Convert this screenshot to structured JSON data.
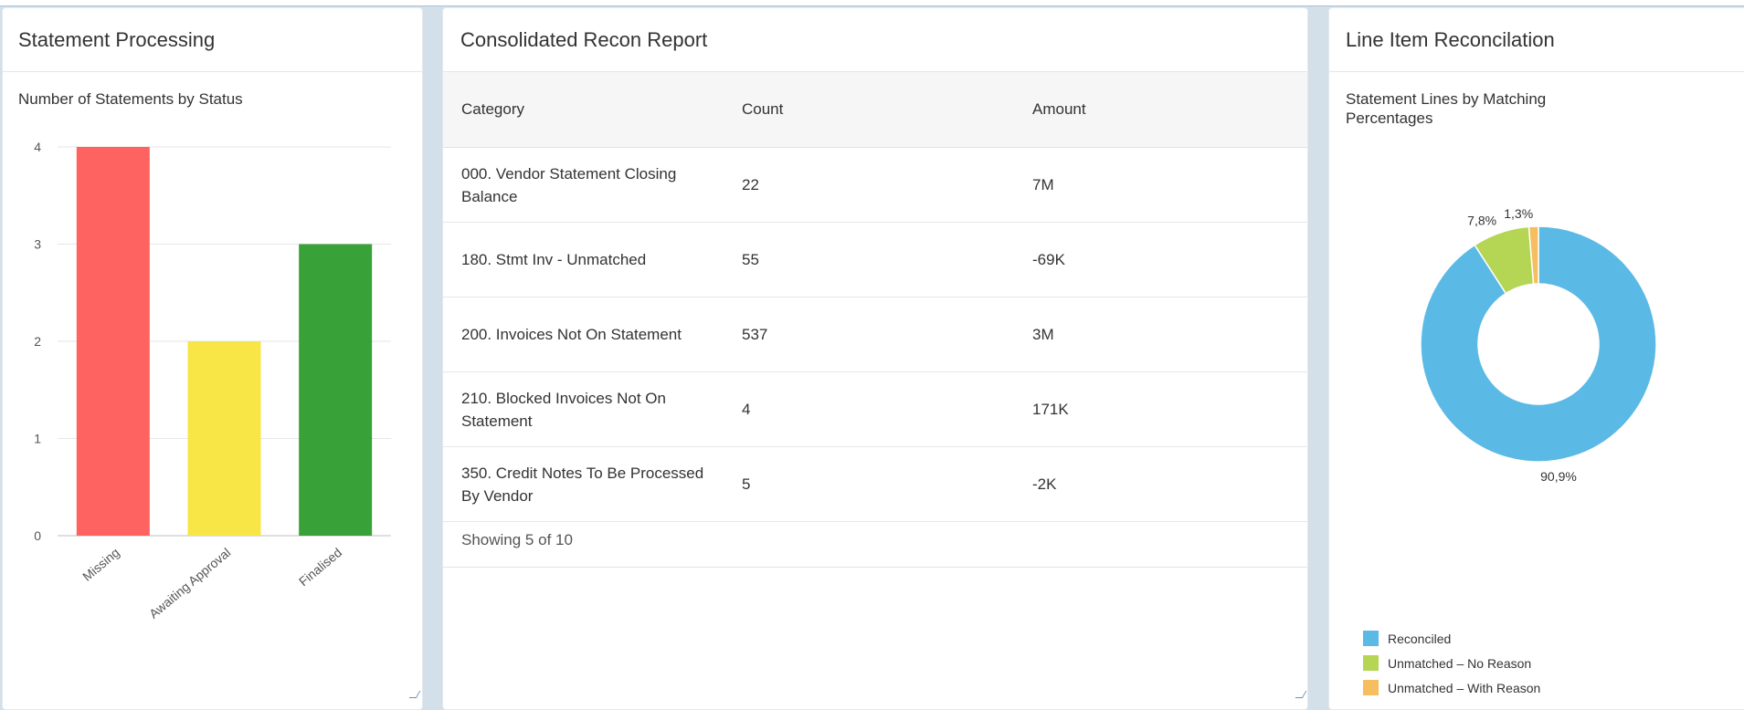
{
  "panels": {
    "statement_processing": {
      "title": "Statement Processing",
      "subtitle": "Number of Statements by Status"
    },
    "recon_report": {
      "title": "Consolidated Recon Report",
      "columns": [
        "Category",
        "Count",
        "Amount"
      ],
      "rows": [
        {
          "category": "000. Vendor Statement Closing Balance",
          "count": "22",
          "amount": "7M"
        },
        {
          "category": "180. Stmt Inv - Unmatched",
          "count": "55",
          "amount": "-69K"
        },
        {
          "category": "200. Invoices Not On Statement",
          "count": "537",
          "amount": "3M"
        },
        {
          "category": "210. Blocked Invoices Not On Statement",
          "count": "4",
          "amount": "171K"
        },
        {
          "category": "350. Credit Notes To Be Processed By Vendor",
          "count": "5",
          "amount": "-2K"
        }
      ],
      "footer": "Showing 5 of 10"
    },
    "line_item": {
      "title": "Line Item Reconcilation",
      "subtitle": "Statement Lines by Matching Percentages"
    }
  },
  "chart_data": [
    {
      "type": "bar",
      "title": "Number of Statements by Status",
      "categories": [
        "Missing",
        "Awaiting Approval",
        "Finalised"
      ],
      "values": [
        4,
        2,
        3
      ],
      "colors": [
        "#ff6361",
        "#f7e645",
        "#38a137"
      ],
      "ylim": [
        0,
        4
      ],
      "yticks": [
        "0",
        "1",
        "2",
        "3",
        "4"
      ],
      "grid": true
    },
    {
      "type": "pie",
      "donut": true,
      "title": "Statement Lines by Matching Percentages",
      "categories": [
        "Reconciled",
        "Unmatched – No Reason",
        "Unmatched – With Reason"
      ],
      "values": [
        90.9,
        7.8,
        1.3
      ],
      "labels": [
        "90,9%",
        "7,8%",
        "1,3%"
      ],
      "colors": [
        "#5bb9e6",
        "#b5d554",
        "#f5be5e"
      ],
      "legend": "bottom-left"
    }
  ]
}
